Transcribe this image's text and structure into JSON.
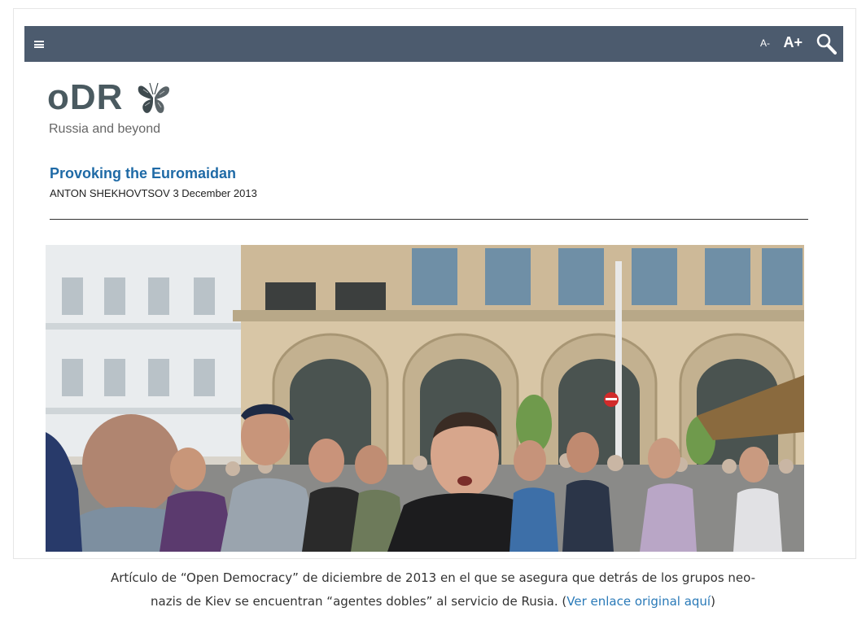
{
  "toolbar": {
    "font_decrease_label": "A-",
    "font_increase_label": "A+",
    "menu_icon": "hamburger-icon",
    "search_icon": "search-icon"
  },
  "site": {
    "logo_text": "oDR",
    "logo_icon": "butterfly-icon",
    "tagline": "Russia and beyond"
  },
  "article": {
    "title": "Provoking the Euromaidan",
    "byline": "ANTON SHEKHOVTSOV 3 December 2013",
    "image_alt": "crowd-photo"
  },
  "caption": {
    "line1": "Artículo de “Open Democracy” de diciembre de 2013 en el que se asegura que detrás de los grupos neo-",
    "line2_before": "nazis de Kiev se encuentran “agentes dobles” al servicio de Rusia. (",
    "link_text": "Ver enlace original aquí",
    "line2_after": ")"
  },
  "colors": {
    "toolbar_bg": "#4c5b6e",
    "title_blue": "#1f6aa6",
    "link_blue": "#2a7ab8"
  }
}
